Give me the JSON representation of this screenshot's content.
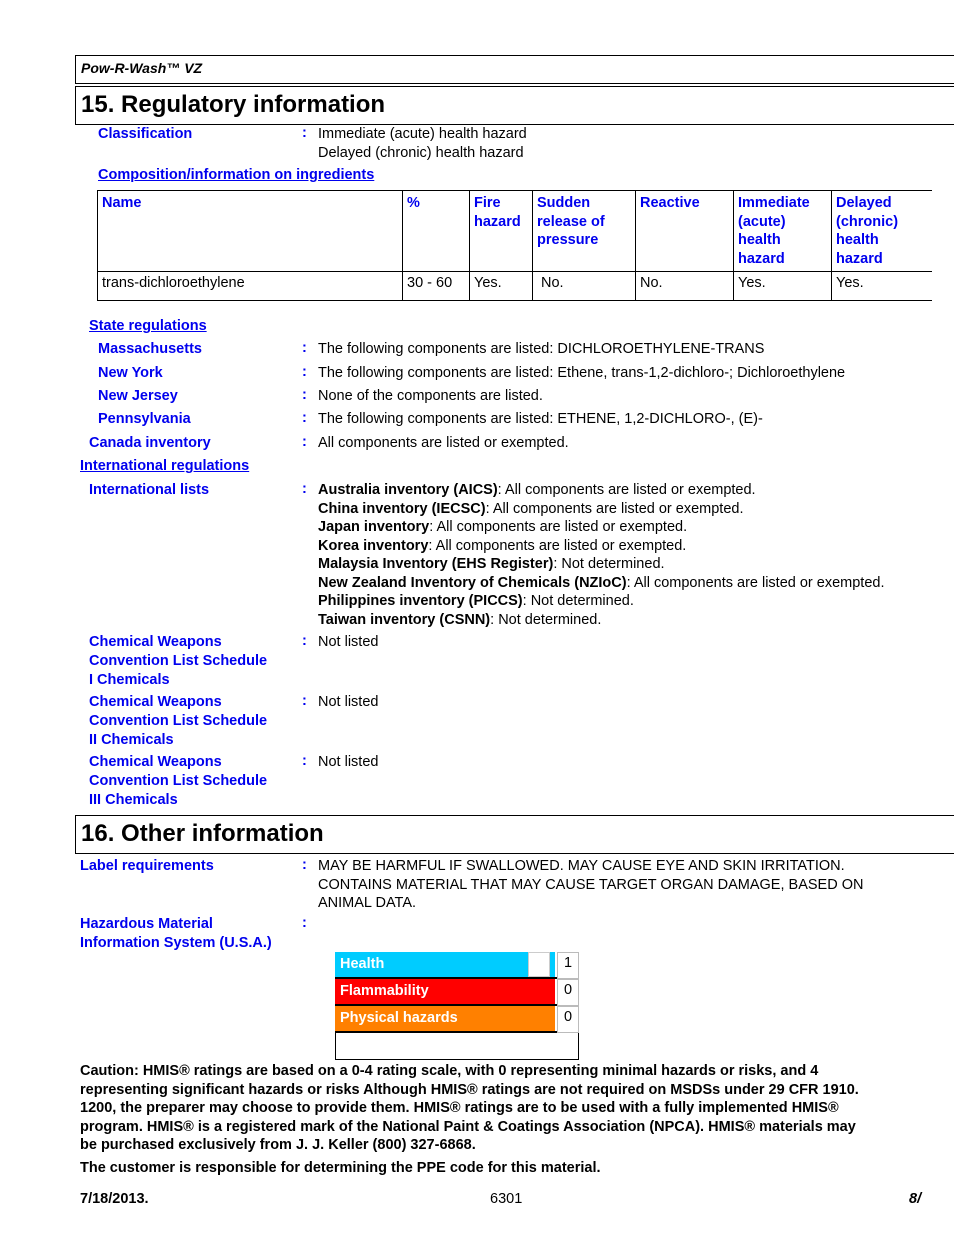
{
  "header": {
    "product": "Pow-R-Wash™ VZ"
  },
  "section15": {
    "title": "15. Regulatory information",
    "classification": {
      "label": "Classification",
      "values": [
        "Immediate (acute) health hazard",
        "Delayed (chronic) health hazard"
      ]
    },
    "composition": {
      "title": "Composition/information on ingredients",
      "columns": [
        "Name",
        "%",
        "Fire hazard",
        "Sudden release of pressure",
        "Reactive",
        "Immediate (acute) health hazard",
        "Delayed (chronic) health hazard"
      ],
      "rows": [
        [
          "trans-dichloroethylene",
          "30 - 60",
          "Yes.",
          "No.",
          "No.",
          "Yes.",
          "Yes."
        ]
      ]
    },
    "state_regulations": {
      "title": "State regulations",
      "items": [
        {
          "label": "Massachusetts",
          "value": "The following components are listed: DICHLOROETHYLENE-TRANS"
        },
        {
          "label": "New York",
          "value": "The following components are listed: Ethene, trans-1,2-dichloro-; Dichloroethylene"
        },
        {
          "label": "New Jersey",
          "value": "None of the components are listed."
        },
        {
          "label": "Pennsylvania",
          "value": "The following components are listed: ETHENE, 1,2-DICHLORO-, (E)-"
        }
      ]
    },
    "canada": {
      "label": "Canada inventory",
      "value": "All components are listed or exempted."
    },
    "international_regulations": {
      "title": "International regulations"
    },
    "international_lists": {
      "label": "International lists",
      "items": [
        {
          "name": "Australia inventory (AICS)",
          "value": ": All components are listed or exempted."
        },
        {
          "name": "China inventory (IECSC)",
          "value": ": All components are listed or exempted."
        },
        {
          "name": "Japan inventory",
          "value": ": All components are listed or exempted."
        },
        {
          "name": "Korea inventory",
          "value": ": All components are listed or exempted."
        },
        {
          "name": "Malaysia Inventory (EHS Register)",
          "value": ": Not determined."
        },
        {
          "name": "New Zealand Inventory of Chemicals (NZIoC)",
          "value": ": All components are listed or exempted."
        },
        {
          "name": "Philippines inventory (PICCS)",
          "value": ": Not determined."
        },
        {
          "name": "Taiwan inventory (CSNN)",
          "value": ": Not determined."
        }
      ]
    },
    "cwc": [
      {
        "label_lines": [
          "Chemical Weapons",
          "Convention List Schedule",
          "I Chemicals"
        ],
        "value": "Not listed"
      },
      {
        "label_lines": [
          "Chemical Weapons",
          "Convention List Schedule",
          "II Chemicals"
        ],
        "value": "Not listed"
      },
      {
        "label_lines": [
          "Chemical Weapons",
          "Convention List Schedule",
          "III Chemicals"
        ],
        "value": "Not listed"
      }
    ]
  },
  "section16": {
    "title": "16. Other information",
    "label_requirements": {
      "label": "Label requirements",
      "value_lines": [
        "MAY BE HARMFUL IF SWALLOWED.  MAY CAUSE EYE AND SKIN IRRITATION.",
        "CONTAINS MATERIAL THAT MAY CAUSE TARGET ORGAN DAMAGE, BASED ON",
        "ANIMAL DATA."
      ]
    },
    "hmis": {
      "label_lines": [
        "Hazardous Material",
        "Information System (U.S.A.)"
      ],
      "rows": [
        {
          "label": "Health",
          "value": "1",
          "color": "#00ccff"
        },
        {
          "label": "Flammability",
          "value": "0",
          "color": "#ff0000"
        },
        {
          "label": "Physical hazards",
          "value": "0",
          "color": "#ff8000"
        }
      ],
      "ppe": ""
    },
    "caution_lines": [
      "Caution: HMIS® ratings are based on a 0-4 rating scale, with 0 representing minimal hazards or risks, and 4",
      "representing significant hazards or risks Although HMIS® ratings are not required on MSDSs under 29 CFR 1910.",
      "1200, the preparer may choose to provide them. HMIS® ratings are to be used with a fully implemented HMIS®",
      "program. HMIS® is a registered mark of the National Paint & Coatings Association (NPCA). HMIS® materials may",
      "be purchased exclusively from J. J. Keller (800) 327-6868."
    ],
    "ppe_note": "The customer is responsible for determining the PPE code for this material."
  },
  "footer": {
    "date": "7/18/2013.",
    "code": "6301",
    "page": "8/"
  },
  "colon": ":"
}
